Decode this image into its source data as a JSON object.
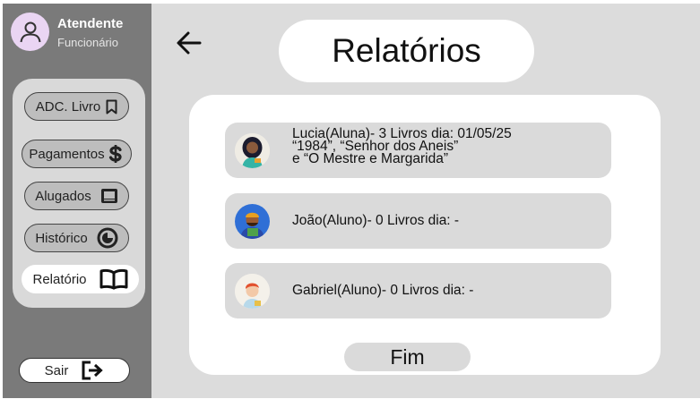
{
  "user": {
    "name": "Atendente",
    "role": "Funcionário",
    "avatar_icon": "user-icon"
  },
  "menu": {
    "items": [
      {
        "label": "ADC. Livro",
        "icon": "bookmark-icon"
      },
      {
        "label": "Pagamentos",
        "icon": "dollar-icon"
      },
      {
        "label": "Alugados",
        "icon": "laptop-icon"
      },
      {
        "label": "Histórico",
        "icon": "clock-icon"
      },
      {
        "label": "Relatório",
        "icon": "open-book-icon",
        "active": true
      }
    ],
    "logout_label": "Sair"
  },
  "page": {
    "title": "Relatórios",
    "back_icon": "arrow-left-icon"
  },
  "report": {
    "entries": [
      {
        "text": "Lucia(Aluna)- 3 Livros dia: 01/05/25\n“1984”, “Senhor dos Aneis”\n e “O Mestre e Margarida”",
        "avatar": "woman-avatar"
      },
      {
        "text": "João(Aluno)- 0 Livros dia: -",
        "avatar": "man-beanie-avatar"
      },
      {
        "text": "Gabriel(Aluno)- 0 Livros dia: -",
        "avatar": "boy-redhair-avatar"
      }
    ],
    "finish_label": "Fim"
  },
  "colors": {
    "sidebar": "#7a7a7a",
    "main_bg": "#dcdcdc",
    "panel": "#d9d9d9",
    "pill": "#bdbdbd",
    "active": "#ffffff"
  }
}
